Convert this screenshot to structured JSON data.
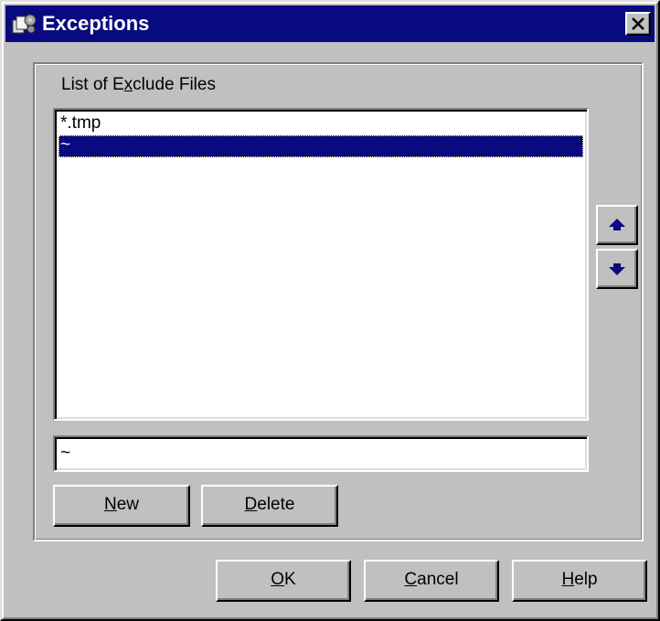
{
  "window": {
    "title": "Exceptions",
    "icon": "files-gear-icon",
    "close_icon": "close-icon"
  },
  "group": {
    "label_prefix": "List of E",
    "label_mnemonic": "x",
    "label_suffix": "clude Files"
  },
  "list": {
    "items": [
      {
        "text": "*.tmp",
        "selected": false
      },
      {
        "text": "~",
        "selected": true
      }
    ]
  },
  "reorder": {
    "up_icon": "arrow-up-icon",
    "down_icon": "arrow-down-icon"
  },
  "edit": {
    "value": "~"
  },
  "buttons": {
    "new": {
      "mnemonic": "N",
      "rest": "ew"
    },
    "delete": {
      "mnemonic": "D",
      "rest": "elete"
    },
    "ok": {
      "mnemonic": "O",
      "rest": "K"
    },
    "cancel": {
      "mnemonic": "C",
      "rest": "ancel"
    },
    "help": {
      "mnemonic": "H",
      "rest": "elp"
    }
  },
  "colors": {
    "face": "#c0c0c0",
    "titlebar": "#0a0a80",
    "selection": "#0a0a80",
    "arrow": "#0a0a80"
  }
}
